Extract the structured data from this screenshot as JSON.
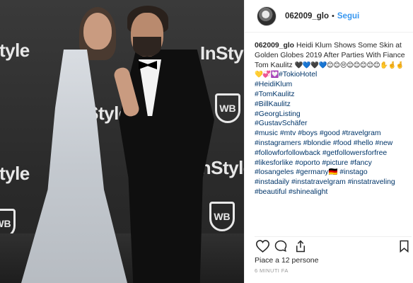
{
  "photo": {
    "backdrop_texts": [
      "InStyle",
      "InStyle",
      "InStyle",
      "InStyle",
      "InStyle"
    ],
    "shield_text": "WB"
  },
  "post": {
    "username": "062009_glo",
    "separator": "•",
    "follow_label": "Segui",
    "caption_user": "062009_glo",
    "caption_text": "Heidi Klum Shows Some Skin at Golden Globes 2019 After Parties With Fiance Tom Kaulitz",
    "caption_emojis": "🖤💙🖤💙😊😊😒😊😊😊😊😊✋🤞🤞💛💞💟",
    "hashtags": [
      "#TokioHotel",
      "#HeidiKlum",
      "#TomKaulitz",
      "#BillKaulitz",
      "#GeorgListing",
      "#GustavSchäfer",
      "#music",
      "#mtv",
      "#boys",
      "#good",
      "#travelgram",
      "#instagramers",
      "#blondie",
      "#food",
      "#hello",
      "#new",
      "#followforfollowback",
      "#getfollowersforfree",
      "#likesforlike",
      "#oporto",
      "#picture",
      "#fancy",
      "#losangeles",
      "#germany🇩🇪",
      "#instago",
      "#instadaily",
      "#instatravelgram",
      "#instatraveling",
      "#beautiful",
      "#shinealight"
    ],
    "likes_text": "Piace a 12 persone",
    "timestamp": "6 MINUTI FA"
  },
  "icons": {
    "like": "heart-icon",
    "comment": "comment-icon",
    "share": "share-icon",
    "save": "bookmark-icon"
  },
  "colors": {
    "link": "#3897f0",
    "hashtag": "#003569",
    "text": "#262626"
  }
}
